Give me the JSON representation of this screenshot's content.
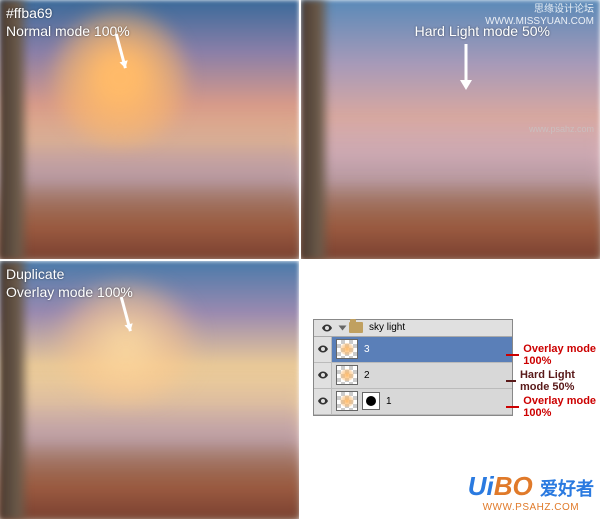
{
  "panel1": {
    "color_hex": "#ffba69",
    "mode_label": "Normal mode 100%"
  },
  "panel2": {
    "mode_label": "Hard Light mode 50%",
    "watermark_cn": "思缘设计论坛",
    "watermark_url": "WWW.MISSYUAN.COM",
    "watermark_mid": "www.psahz.com"
  },
  "panel3": {
    "line1": "Duplicate",
    "line2": "Overlay mode 100%"
  },
  "layers": {
    "group_name": "sky light",
    "row1_name": "3",
    "row2_name": "2",
    "row3_name": "1"
  },
  "annotations": {
    "a1": "Overlay mode 100%",
    "a2": "Hard Light mode 50%",
    "a3": "Overlay mode 100%"
  },
  "logo": {
    "text": "UiBO",
    "cn": "爱好者",
    "url": "WWW.PSAHZ.COM"
  }
}
